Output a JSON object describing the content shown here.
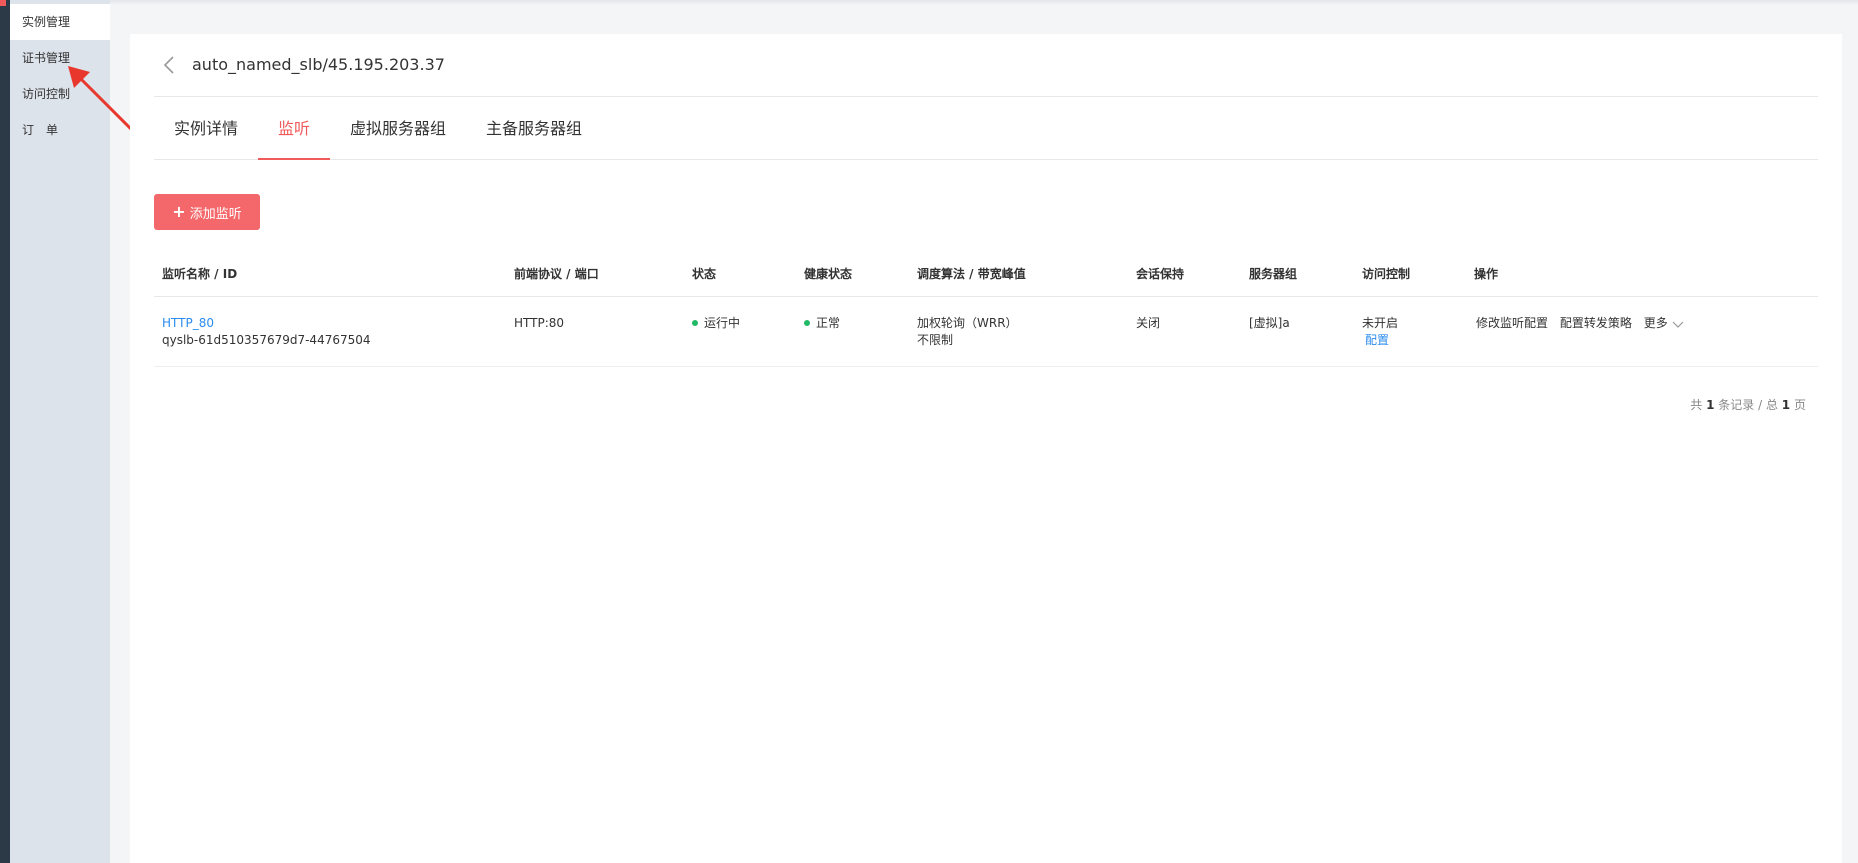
{
  "sidebar": {
    "items": [
      {
        "label": "实例管理"
      },
      {
        "label": "证书管理"
      },
      {
        "label": "访问控制"
      },
      {
        "label": "订　单"
      }
    ]
  },
  "header": {
    "title": "auto_named_slb/45.195.203.37"
  },
  "tabs": [
    {
      "label": "实例详情"
    },
    {
      "label": "监听"
    },
    {
      "label": "虚拟服务器组"
    },
    {
      "label": "主备服务器组"
    }
  ],
  "toolbar": {
    "add_label": "添加监听"
  },
  "table": {
    "columns": [
      "监听名称 / ID",
      "前端协议 / 端口",
      "状态",
      "健康状态",
      "调度算法 / 带宽峰值",
      "会话保持",
      "服务器组",
      "访问控制",
      "操作"
    ],
    "rows": [
      {
        "name": "HTTP_80",
        "id": "qyslb-61d510357679d7-44767504",
        "protocol_port": "HTTP:80",
        "status": "运行中",
        "health": "正常",
        "algorithm": "加权轮询（WRR）",
        "bandwidth": "不限制",
        "session": "关闭",
        "server_group": "[虚拟]a",
        "acl_status": "未开启",
        "acl_config": "配置",
        "op_modify": "修改监听配置",
        "op_forward": "配置转发策略",
        "op_more": "更多"
      }
    ]
  },
  "pager": {
    "prefix": "共",
    "total": "1",
    "mid": "条记录 / 总",
    "pages": "1",
    "suffix": "页"
  },
  "colors": {
    "accent": "#f05a5a",
    "button": "#f4676a",
    "link": "#2b8cf0",
    "status_ok": "#21b866",
    "annotation_arrow": "#e8372c"
  }
}
